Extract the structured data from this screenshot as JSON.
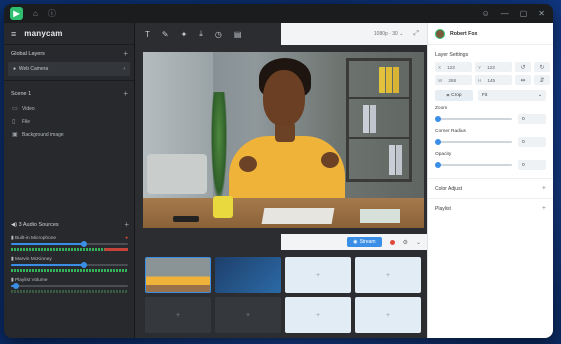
{
  "app": {
    "brand": "manycam",
    "logo_letter": "▶"
  },
  "left_panel": {
    "global_layers_title": "Global Layers",
    "layer_item": "Web Camera",
    "scene_title": "Scene 1",
    "sources": [
      {
        "icon": "video-icon",
        "label": "Video"
      },
      {
        "icon": "file-icon",
        "label": "File"
      },
      {
        "icon": "image-icon",
        "label": "Background image"
      }
    ],
    "audio_title": "3 Audio Sources",
    "audio_sources": [
      {
        "label": "Built-in Microphone",
        "level": 0.6
      },
      {
        "label": "Marvin McKinney",
        "level": 0.6
      },
      {
        "label": "Playlist Volume",
        "level": 0.05
      }
    ]
  },
  "toolbar": {
    "resolution": "1080p · 30 ⌄"
  },
  "stream": {
    "stream_label": "Stream"
  },
  "right_panel": {
    "user_name": "Robert Fox",
    "layer_settings_title": "Layer Settings",
    "fields": [
      {
        "key": "X",
        "value": "123"
      },
      {
        "key": "Y",
        "value": "123"
      },
      {
        "key": "W",
        "value": "268"
      },
      {
        "key": "H",
        "value": "145"
      }
    ],
    "crop_label": "Crop",
    "fit_label": "Fit",
    "properties": [
      {
        "label": "Zoom",
        "value": "0"
      },
      {
        "label": "Corner Radius",
        "value": "0"
      },
      {
        "label": "Opacity",
        "value": "0"
      }
    ],
    "sections": [
      {
        "label": "Color Adjust"
      },
      {
        "label": "Playlist"
      }
    ]
  },
  "colors": {
    "accent": "#3a8ee6",
    "brand_green": "#2fbf71",
    "record_red": "#e04a3c"
  }
}
